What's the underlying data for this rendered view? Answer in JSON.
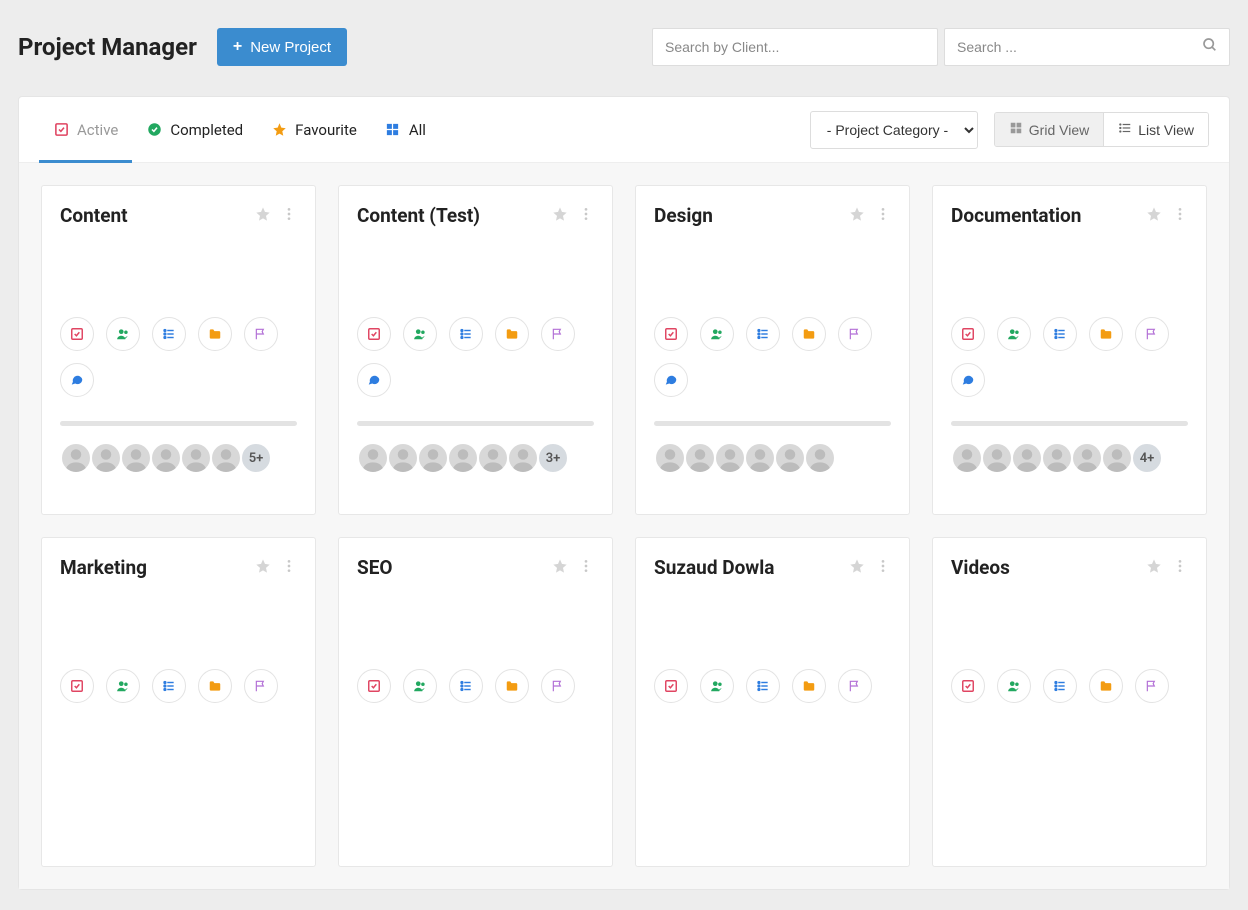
{
  "header": {
    "title": "Project Manager",
    "new_button": "New Project",
    "search_client_placeholder": "Search by Client...",
    "search_placeholder": "Search ..."
  },
  "tabs": {
    "active": "Active",
    "completed": "Completed",
    "favourite": "Favourite",
    "all": "All"
  },
  "filters": {
    "category_label": "- Project Category -",
    "grid_view": "Grid View",
    "list_view": "List View"
  },
  "projects": [
    {
      "title": "Content",
      "more": "5+"
    },
    {
      "title": "Content (Test)",
      "more": "3+"
    },
    {
      "title": "Design",
      "more": ""
    },
    {
      "title": "Documentation",
      "more": "4+"
    },
    {
      "title": "Marketing",
      "more": ""
    },
    {
      "title": "SEO",
      "more": ""
    },
    {
      "title": "Suzaud Dowla",
      "more": ""
    },
    {
      "title": "Videos",
      "more": ""
    }
  ],
  "colors": {
    "primary": "#3b8ccf",
    "red": "#e04562",
    "green": "#22a860",
    "blue": "#2e7de0",
    "orange": "#f39c12",
    "purple": "#b26fd6"
  }
}
